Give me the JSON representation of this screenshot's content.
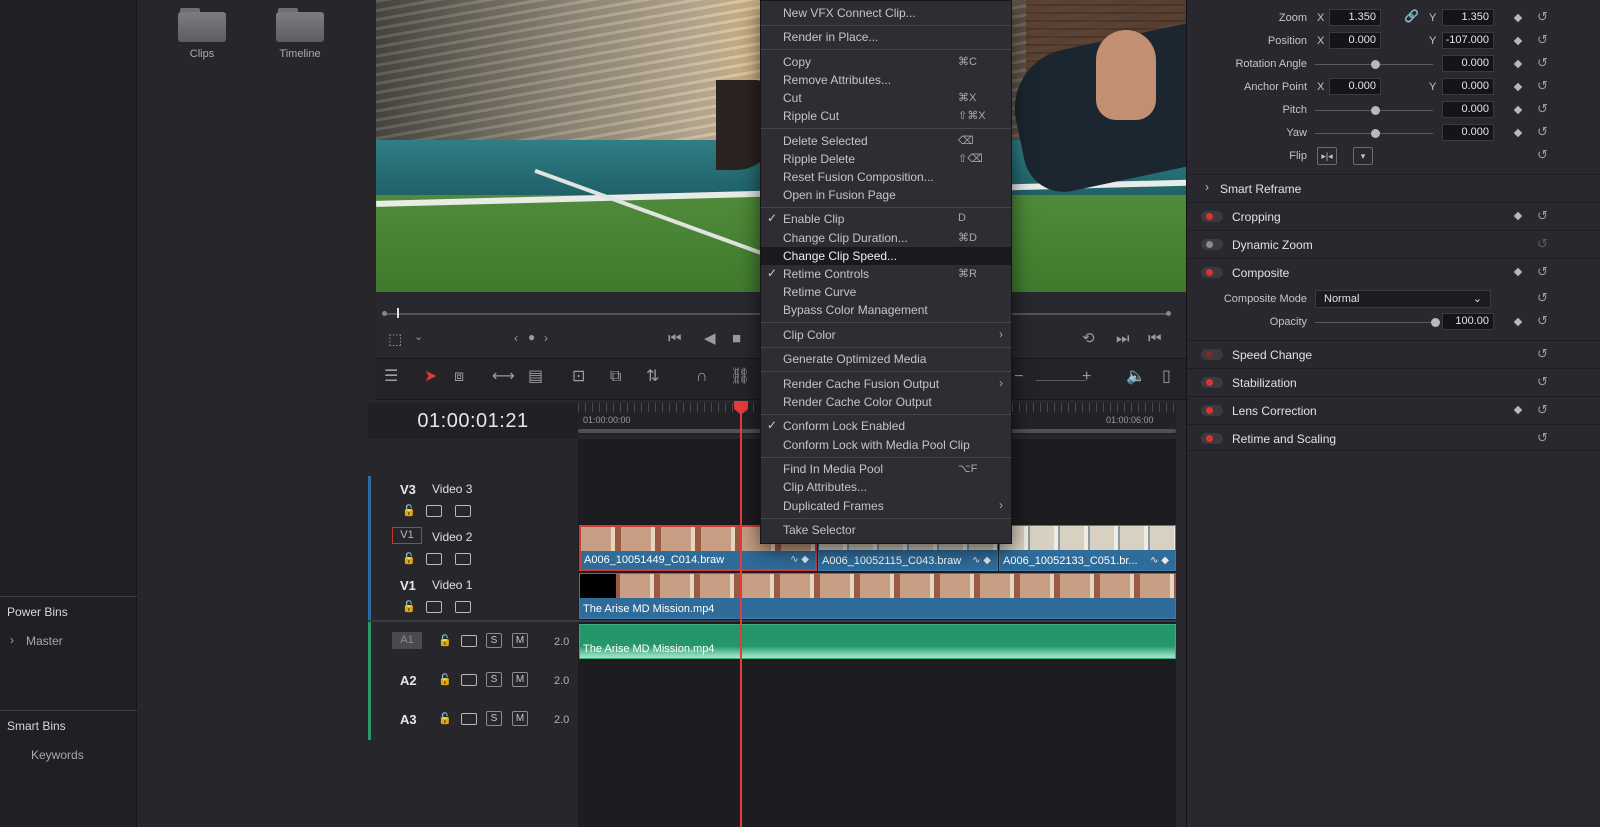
{
  "sidebar": {
    "power_bins_label": "Power Bins",
    "master_label": "Master",
    "smart_bins_label": "Smart Bins",
    "keywords_label": "Keywords"
  },
  "media_pool": {
    "folders": [
      {
        "label": "Clips"
      },
      {
        "label": "Timeline"
      }
    ]
  },
  "timeline": {
    "timecode": "01:00:01:21",
    "ruler_start": "01:00:00:00",
    "ruler_end": "01:00:06:00",
    "tracks": {
      "v3": {
        "id": "V3",
        "name": "Video 3"
      },
      "v2": {
        "id": "V2",
        "name": "Video 2",
        "patch": "V1"
      },
      "v1": {
        "id": "V1",
        "name": "Video 1"
      },
      "a1": {
        "id": "A1",
        "level": "2.0",
        "solo": "S",
        "mute": "M"
      },
      "a2": {
        "id": "A2",
        "level": "2.0",
        "solo": "S",
        "mute": "M"
      },
      "a3": {
        "id": "A3",
        "level": "2.0",
        "solo": "S",
        "mute": "M"
      }
    },
    "clips": {
      "v2_a": "A006_10051449_C014.braw",
      "v2_b": "A006_10052115_C043.braw",
      "v2_c": "A006_10052133_C051.br...",
      "v1": "The Arise MD Mission.mp4",
      "a1": "The Arise MD Mission.mp4"
    }
  },
  "context_menu": {
    "items": [
      {
        "label": "New VFX Connect Clip...",
        "shortcut": ""
      },
      {
        "label": "Render in Place...",
        "shortcut": ""
      },
      {
        "label": "Copy",
        "shortcut": "⌘C"
      },
      {
        "label": "Remove Attributes...",
        "shortcut": ""
      },
      {
        "label": "Cut",
        "shortcut": "⌘X"
      },
      {
        "label": "Ripple Cut",
        "shortcut": "⇧⌘X"
      },
      {
        "label": "Delete Selected",
        "shortcut": "⌫"
      },
      {
        "label": "Ripple Delete",
        "shortcut": "⇧⌫"
      },
      {
        "label": "Reset Fusion Composition...",
        "shortcut": ""
      },
      {
        "label": "Open in Fusion Page",
        "shortcut": ""
      },
      {
        "label": "Enable Clip",
        "shortcut": "D",
        "checked": true
      },
      {
        "label": "Change Clip Duration...",
        "shortcut": "⌘D"
      },
      {
        "label": "Change Clip Speed...",
        "shortcut": "",
        "highlighted": true
      },
      {
        "label": "Retime Controls",
        "shortcut": "⌘R",
        "checked": true
      },
      {
        "label": "Retime Curve",
        "shortcut": ""
      },
      {
        "label": "Bypass Color Management",
        "shortcut": ""
      },
      {
        "label": "Clip Color",
        "shortcut": "",
        "submenu": true
      },
      {
        "label": "Generate Optimized Media",
        "shortcut": ""
      },
      {
        "label": "Render Cache Fusion Output",
        "shortcut": "",
        "submenu": true
      },
      {
        "label": "Render Cache Color Output",
        "shortcut": ""
      },
      {
        "label": "Conform Lock Enabled",
        "shortcut": "",
        "checked": true
      },
      {
        "label": "Conform Lock with Media Pool Clip",
        "shortcut": ""
      },
      {
        "label": "Find In Media Pool",
        "shortcut": "⌥F"
      },
      {
        "label": "Clip Attributes...",
        "shortcut": ""
      },
      {
        "label": "Duplicated Frames",
        "shortcut": "",
        "submenu": true
      },
      {
        "label": "Take Selector",
        "shortcut": ""
      }
    ]
  },
  "inspector": {
    "transform": {
      "zoom": {
        "label": "Zoom",
        "x": "1.350",
        "y": "1.350"
      },
      "position": {
        "label": "Position",
        "x": "0.000",
        "y": "-107.000"
      },
      "rotation": {
        "label": "Rotation Angle",
        "value": "0.000"
      },
      "anchor": {
        "label": "Anchor Point",
        "x": "0.000",
        "y": "0.000"
      },
      "pitch": {
        "label": "Pitch",
        "value": "0.000"
      },
      "yaw": {
        "label": "Yaw",
        "value": "0.000"
      },
      "flip": {
        "label": "Flip"
      },
      "x_label": "X",
      "y_label": "Y"
    },
    "sections": {
      "smart_reframe": "Smart Reframe",
      "cropping": "Cropping",
      "dynamic_zoom": "Dynamic Zoom",
      "composite": "Composite",
      "speed_change": "Speed Change",
      "stabilization": "Stabilization",
      "lens_correction": "Lens Correction",
      "retime_scaling": "Retime and Scaling"
    },
    "composite": {
      "mode_label": "Composite Mode",
      "mode_value": "Normal",
      "opacity_label": "Opacity",
      "opacity_value": "100.00"
    }
  },
  "colors": {
    "playhead": "#e53b3b",
    "video_clip": "#2f6c9a",
    "audio_clip": "#25956a",
    "enabled_dot": "#e2302f"
  }
}
